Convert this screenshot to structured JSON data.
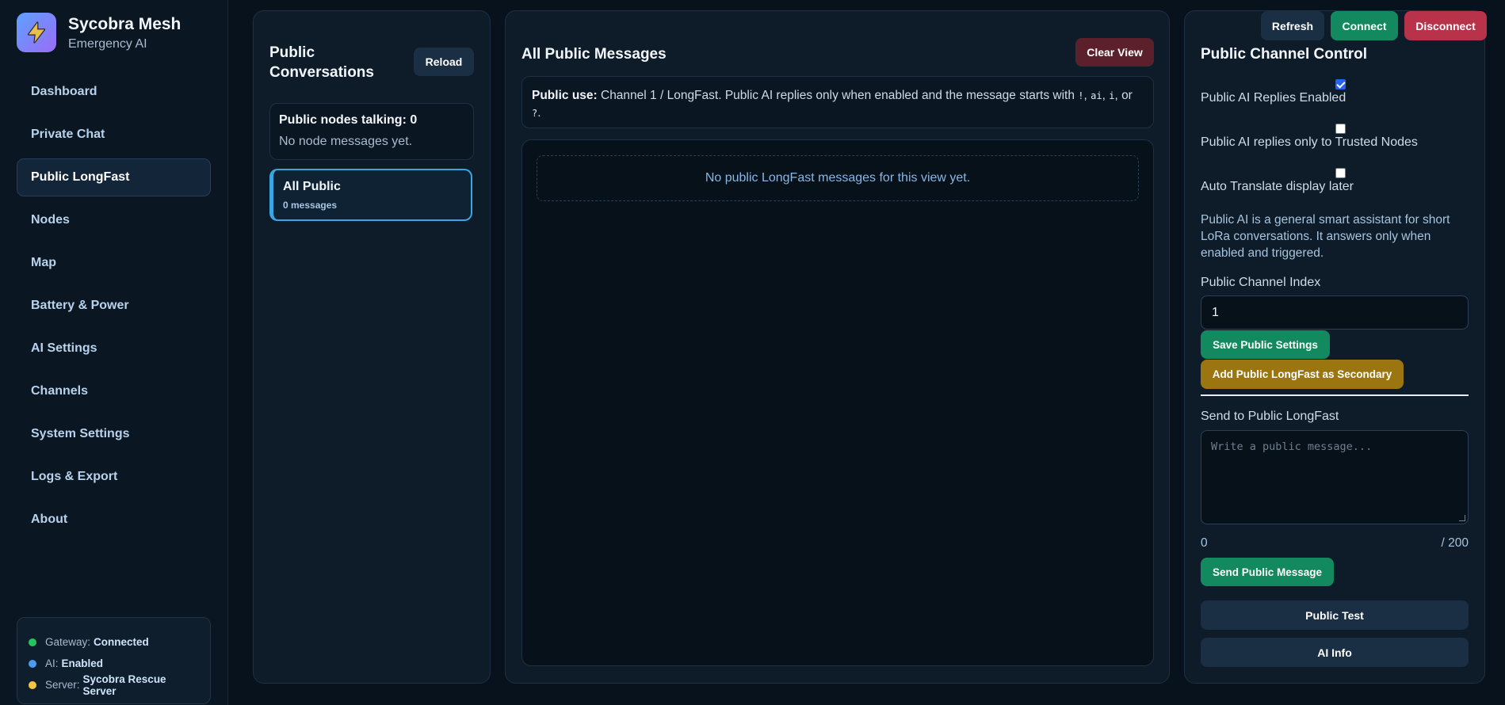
{
  "brand": {
    "title": "Sycobra Mesh",
    "subtitle": "Emergency AI",
    "logo_icon": "lightning-bolt-icon",
    "logo_gradient": [
      "#5ea0ff",
      "#9b6cf6"
    ]
  },
  "nav": {
    "items": [
      {
        "label": "Dashboard",
        "active": false
      },
      {
        "label": "Private Chat",
        "active": false
      },
      {
        "label": "Public LongFast",
        "active": true
      },
      {
        "label": "Nodes",
        "active": false
      },
      {
        "label": "Map",
        "active": false
      },
      {
        "label": "Battery & Power",
        "active": false
      },
      {
        "label": "AI Settings",
        "active": false
      },
      {
        "label": "Channels",
        "active": false
      },
      {
        "label": "System Settings",
        "active": false
      },
      {
        "label": "Logs & Export",
        "active": false
      },
      {
        "label": "About",
        "active": false
      }
    ]
  },
  "status": {
    "gateway_label": "Gateway:",
    "gateway_value": "Connected",
    "gateway_color": "#22c55e",
    "ai_label": "AI:",
    "ai_value": "Enabled",
    "ai_color": "#4b9cf0",
    "server_label": "Server:",
    "server_value": "Sycobra Rescue Server",
    "server_color": "#f5c542"
  },
  "topbar": {
    "refresh": "Refresh",
    "connect": "Connect",
    "disconnect": "Disconnect"
  },
  "conversations": {
    "title": "Public Conversations",
    "reload": "Reload",
    "nodes_talking": "Public nodes talking: 0",
    "nodes_empty": "No node messages yet.",
    "items": [
      {
        "name": "All Public",
        "count": "0 messages",
        "selected": true
      }
    ]
  },
  "messages": {
    "title": "All Public Messages",
    "clear_view": "Clear View",
    "info_bold": "Public use:",
    "info_text": " Channel 1 / LongFast. Public AI replies only when enabled and the message starts with ",
    "triggers": [
      "!",
      "ai",
      "i",
      "?"
    ],
    "empty": "No public LongFast messages for this view yet."
  },
  "control": {
    "title": "Public Channel Control",
    "options": [
      {
        "label": "Public AI Replies Enabled",
        "checked": true
      },
      {
        "label": "Public AI replies only to Trusted Nodes",
        "checked": false
      },
      {
        "label": "Auto Translate display later",
        "checked": false
      }
    ],
    "description": "Public AI is a general smart assistant for short LoRa conversations. It answers only when enabled and triggered.",
    "channel_index_label": "Public Channel Index",
    "channel_index_value": "1",
    "save_button": "Save Public Settings",
    "add_secondary_button": "Add Public LongFast as Secondary",
    "send_label": "Send to Public LongFast",
    "send_placeholder": "Write a public message...",
    "char_count": "0",
    "char_limit": "/ 200",
    "send_button": "Send Public Message",
    "public_test": "Public Test",
    "ai_info": "AI Info"
  }
}
